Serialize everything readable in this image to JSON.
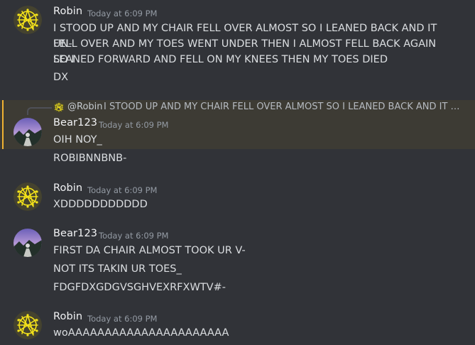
{
  "messages": [
    {
      "author": "Robin",
      "time": "Today at 6:09 PM",
      "lines": [
        "I STOOD UP AND MY CHAIR FELL OVER ALMOST SO I LEANED BACK AND IT UN-",
        "FELL OVER AND MY TOES WENT UNDER THEN I ALMOST FELL BACK AGAIN SO I",
        "LEANED FORWARD AND FELL ON MY KNEES THEN MY TOES DIED",
        "DX"
      ]
    },
    {
      "reply": {
        "mention": "@Robin",
        "text": "I STOOD UP AND MY CHAIR FELL OVER ALMOST SO I LEANED BACK AND IT UN-F..."
      },
      "author": "Bear123",
      "time": "Today at 6:09 PM",
      "lines": [
        "OIH NOY_",
        "ROBIBNNBNB-"
      ]
    },
    {
      "author": "Robin",
      "time": "Today at 6:09 PM",
      "lines": [
        "XDDDDDDDDDDD"
      ]
    },
    {
      "author": "Bear123",
      "time": "Today at 6:09 PM",
      "lines": [
        "FIRST DA CHAIR ALMOST TOOK UR V-",
        "NOT ITS TAKIN UR TOES_",
        "FDGFDXGDGVSGHVEXRFXWTV#-"
      ]
    },
    {
      "author": "Robin",
      "time": "Today at 6:09 PM",
      "lines": [
        "woAAAAAAAAAAAAAAAAAAAAAA"
      ]
    }
  ],
  "colors": {
    "background": "#313338",
    "mention_highlight": "#3d3b34",
    "mention_bar": "#f0b232",
    "author": "#f2f3f5",
    "timestamp": "#949ba4"
  }
}
